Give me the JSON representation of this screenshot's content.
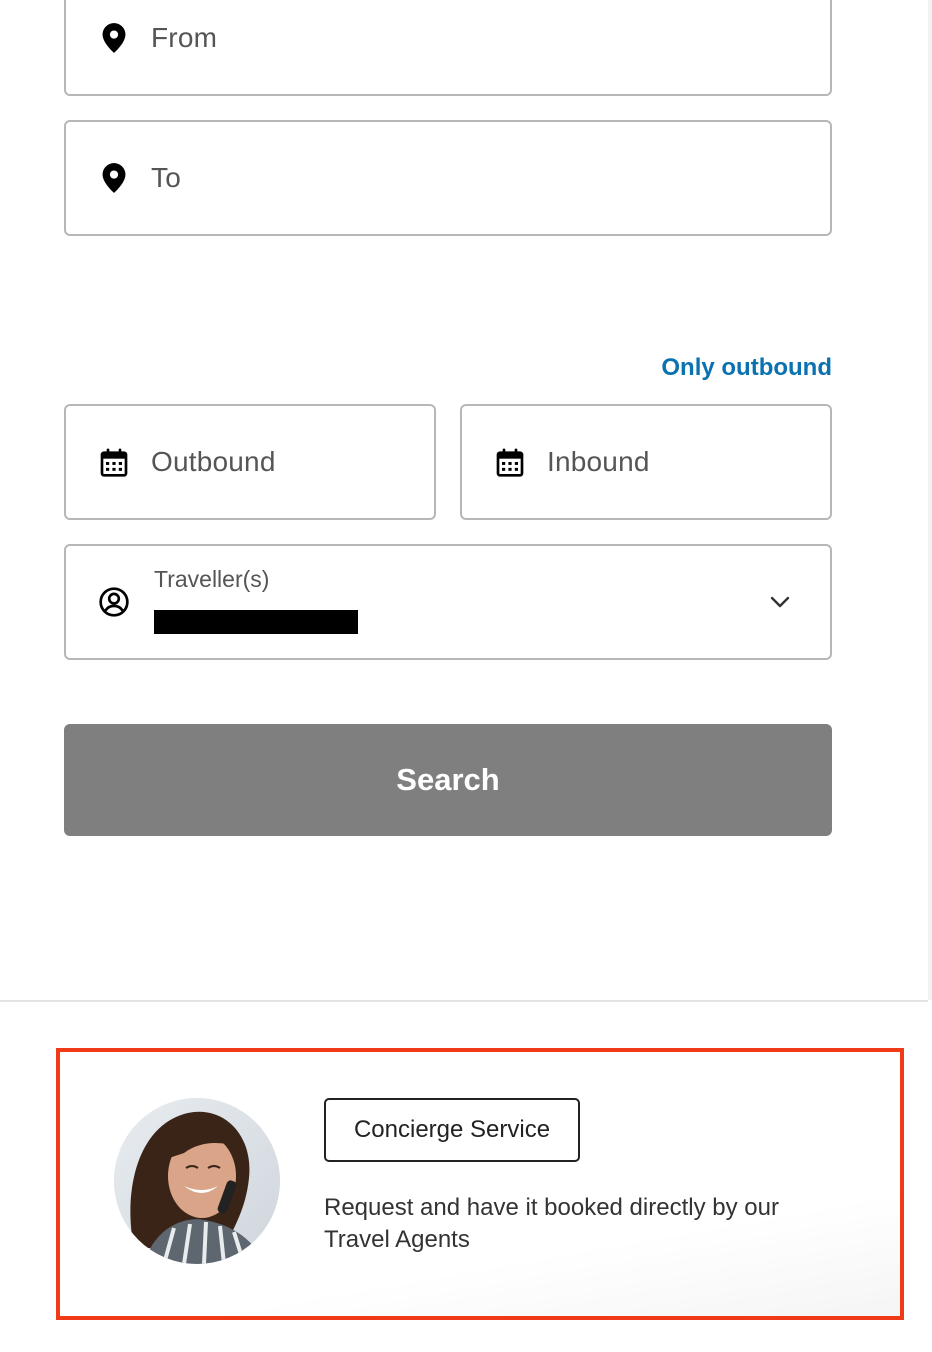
{
  "form": {
    "from_placeholder": "From",
    "to_placeholder": "To",
    "only_outbound_link": "Only outbound",
    "outbound_placeholder": "Outbound",
    "inbound_placeholder": "Inbound",
    "traveller_label": "Traveller(s)",
    "search_label": "Search"
  },
  "icons": {
    "from": "map-pin-icon",
    "to": "map-pin-icon",
    "outbound": "calendar-icon",
    "inbound": "calendar-icon",
    "traveller": "user-circle-icon",
    "dropdown": "chevron-down-icon"
  },
  "concierge": {
    "button_label": "Concierge Service",
    "description": "Request and have it booked directly by our Travel Agents"
  },
  "colors": {
    "link": "#0a72b0",
    "search_button_bg": "#7f7f7f",
    "highlight_border": "#f03a17",
    "field_border": "#b7b7b7"
  }
}
